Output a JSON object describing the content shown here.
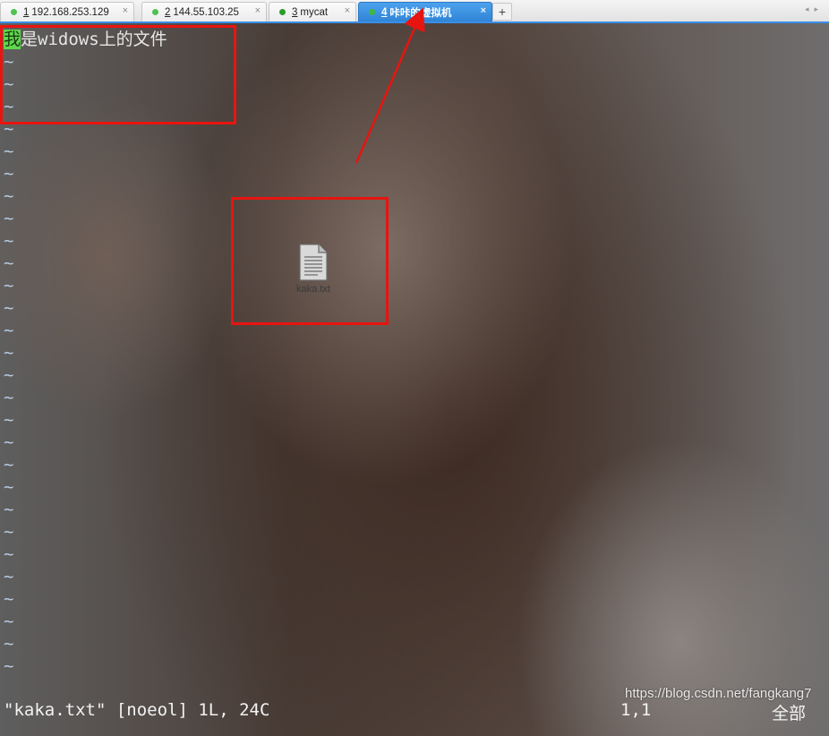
{
  "tabs": [
    {
      "number": "1",
      "title": "192.168.253.129",
      "dot_color": "#4ec24e",
      "active": false
    },
    {
      "number": "2",
      "title": "144.55.103.25",
      "dot_color": "#4ec24e",
      "active": false
    },
    {
      "number": "3",
      "title": "mycat",
      "dot_color": "#2a9d2a",
      "active": false
    },
    {
      "number": "4",
      "title": "咔咔的虚拟机",
      "dot_color": "#3fb83f",
      "active": true
    }
  ],
  "tab_add_label": "+",
  "tab_close_glyph": "×",
  "tab_scroll_glyphs": "◂▸",
  "editor": {
    "cursor_char": "我",
    "first_line_rest": "是widows上的文件",
    "tilde": "~",
    "empty_line_count": 28
  },
  "status": {
    "message": "\"kaka.txt\" [noeol] 1L, 24C",
    "position": "1,1",
    "scroll": "全部"
  },
  "desktop_file": {
    "label": "kaka.txt"
  },
  "watermark": "https://blog.csdn.net/fangkang7",
  "colors": {
    "annotation_red": "#e8140f",
    "cursor_green": "#5dd84f",
    "active_tab_blue": "#2f84d6"
  }
}
